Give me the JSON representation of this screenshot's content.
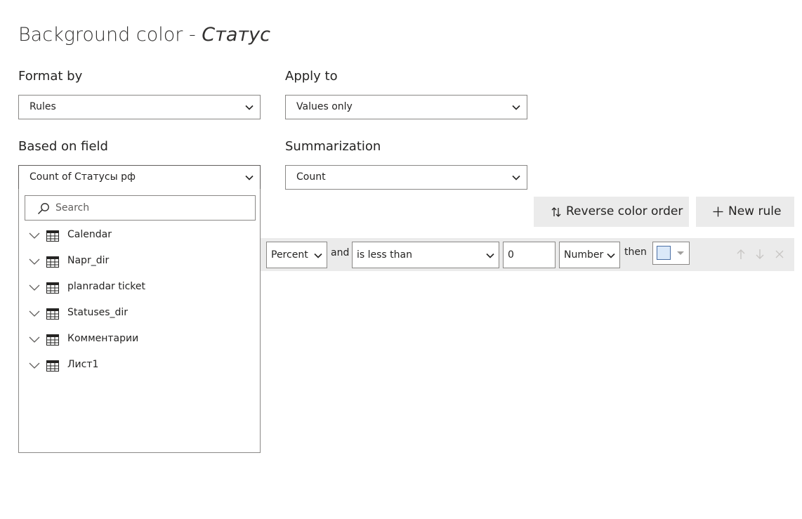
{
  "dialog": {
    "title_prefix": "Background color - ",
    "title_field": "Статус"
  },
  "format_by": {
    "label": "Format by",
    "value": "Rules"
  },
  "apply_to": {
    "label": "Apply to",
    "value": "Values only"
  },
  "based_on_field": {
    "label": "Based on field",
    "value": "Count of Статусы рф"
  },
  "summarization": {
    "label": "Summarization",
    "value": "Count"
  },
  "field_dropdown": {
    "search_placeholder": "Search",
    "items": [
      {
        "label": "Calendar",
        "icon": "table-icon"
      },
      {
        "label": "Napr_dir",
        "icon": "table-icon"
      },
      {
        "label": "planradar ticket",
        "icon": "table-icon"
      },
      {
        "label": "Statuses_dir",
        "icon": "table-icon"
      },
      {
        "label": "Комментарии",
        "icon": "table-icon"
      },
      {
        "label": "Лист1",
        "icon": "table-icon"
      }
    ]
  },
  "buttons": {
    "reverse_color_order": "Reverse color order",
    "new_rule": "New rule"
  },
  "rule": {
    "unit": "Percent",
    "and_text": "and",
    "operator": "is less than",
    "value": "0",
    "value_type": "Number",
    "then_text": "then",
    "color": "#dbe9f9"
  }
}
